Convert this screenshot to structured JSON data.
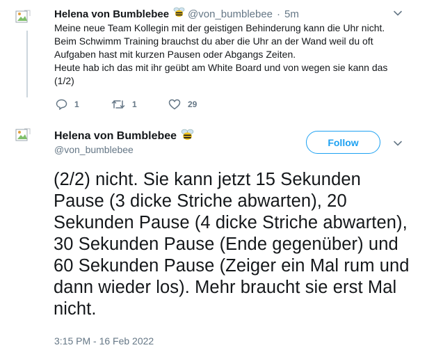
{
  "tweet1": {
    "name": "Helena von Bumblebee",
    "handle": "@von_bumblebee",
    "sep": "·",
    "time": "5m",
    "text": "Meine neue Team Kollegin mit der geistigen Behinderung kann die Uhr nicht. Beim Schwimm Training brauchst du aber die Uhr an der Wand weil du oft Aufgaben hast mit kurzen Pausen oder Abgangs Zeiten.\nHeute hab ich das mit ihr geübt am White Board und von wegen sie kann das (1/2)",
    "replies": "1",
    "retweets": "1",
    "likes": "29"
  },
  "tweet2": {
    "name": "Helena von Bumblebee",
    "handle": "@von_bumblebee",
    "follow_label": "Follow",
    "text": "(2/2) nicht. Sie kann jetzt 15 Sekunden Pause (3 dicke Striche abwarten), 20 Sekunden Pause (4 dicke Striche abwarten), 30 Sekunden Pause (Ende gegenüber) und 60 Sekunden Pause (Zeiger ein Mal rum und dann wieder los). Mehr braucht sie erst Mal nicht.",
    "timestamp": "3:15 PM - 16 Feb 2022"
  },
  "icons": [
    "bee-emoji-icon",
    "chevron-down-icon",
    "reply-icon",
    "retweet-icon",
    "like-icon",
    "broken-avatar-icon"
  ],
  "colors": {
    "accent": "#1da1f2",
    "muted": "#657786",
    "line": "#ccd6dd"
  }
}
